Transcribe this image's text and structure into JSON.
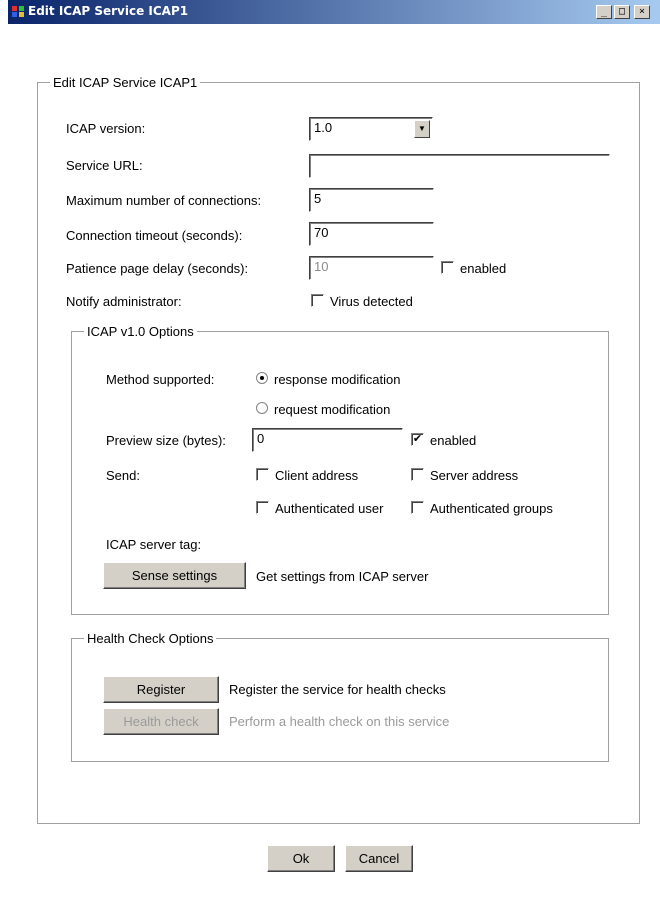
{
  "window": {
    "title": "Edit ICAP Service ICAP1",
    "controls": {
      "minimize": "_",
      "maximize": "□",
      "close": "×"
    }
  },
  "main_group": {
    "legend": "Edit ICAP Service ICAP1",
    "icap_version": {
      "label": "ICAP version:",
      "value": "1.0"
    },
    "service_url": {
      "label": "Service URL:",
      "value": ""
    },
    "max_connections": {
      "label": "Maximum number of connections:",
      "value": "5"
    },
    "connection_timeout": {
      "label": "Connection timeout (seconds):",
      "value": "70"
    },
    "patience_delay": {
      "label": "Patience page delay (seconds):",
      "value": "10",
      "enabled_label": "enabled",
      "enabled": false
    },
    "notify_admin": {
      "label": "Notify administrator:",
      "checkbox_label": "Virus detected",
      "checked": false
    }
  },
  "options_group": {
    "legend": "ICAP v1.0 Options",
    "method_label": "Method supported:",
    "method_options": [
      {
        "label": "response modification",
        "selected": true
      },
      {
        "label": "request modification",
        "selected": false
      }
    ],
    "preview": {
      "label": "Preview size (bytes):",
      "value": "0",
      "enabled_label": "enabled",
      "enabled": true
    },
    "send_label": "Send:",
    "send_options": {
      "client_address": {
        "label": "Client address",
        "checked": false
      },
      "server_address": {
        "label": "Server address",
        "checked": false
      },
      "auth_user": {
        "label": "Authenticated user",
        "checked": false
      },
      "auth_groups": {
        "label": "Authenticated groups",
        "checked": false
      }
    },
    "server_tag_label": "ICAP server tag:",
    "sense_button": "Sense settings",
    "sense_desc": "Get settings from ICAP server"
  },
  "health_group": {
    "legend": "Health Check Options",
    "register_button": "Register",
    "register_desc": "Register the service for health checks",
    "health_button": "Health check",
    "health_desc": "Perform a health check on this service"
  },
  "footer": {
    "ok": "Ok",
    "cancel": "Cancel"
  },
  "colors": {
    "titlebar_start": "#0a246a",
    "titlebar_end": "#a6caf0",
    "face": "#d4d0c8"
  },
  "icons": {
    "app": "app-icon",
    "checkmark": "✔"
  }
}
